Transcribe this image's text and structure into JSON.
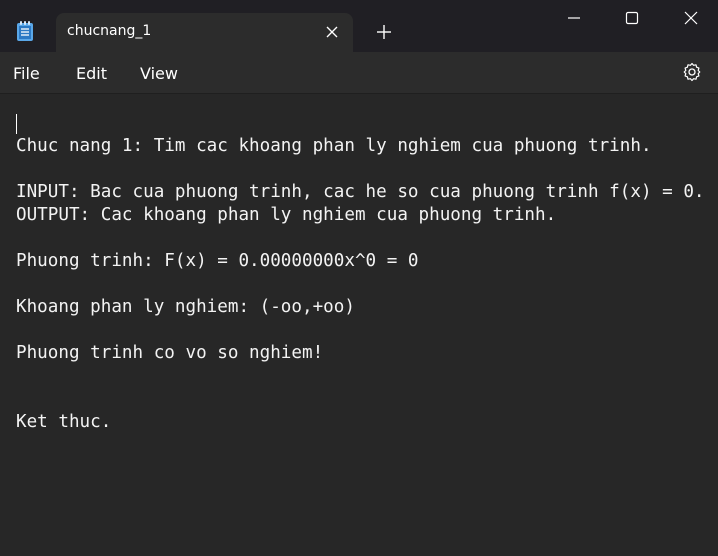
{
  "window": {
    "tab_title": "chucnang_1",
    "app_icon": "notepad-icon",
    "new_tab_icon": "plus-icon",
    "minimize_icon": "minimize-icon",
    "maximize_icon": "maximize-icon",
    "close_icon": "close-icon"
  },
  "menu": {
    "file": "File",
    "edit": "Edit",
    "view": "View",
    "settings_icon": "gear-icon"
  },
  "editor": {
    "content": "Chuc nang 1: Tim cac khoang phan ly nghiem cua phuong trinh.\n\nINPUT: Bac cua phuong trinh, cac he so cua phuong trinh f(x) = 0.\nOUTPUT: Cac khoang phan ly nghiem cua phuong trinh.\n\nPhuong trinh: F(x) = 0.00000000x^0 = 0\n\nKhoang phan ly nghiem: (-oo,+oo)\n\nPhuong trinh co vo so nghiem!\n\n\nKet thuc."
  },
  "colors": {
    "titlebar_bg": "#201f24",
    "tab_bg": "#2c2c2c",
    "editor_bg": "#272727",
    "text": "#ffffff"
  }
}
